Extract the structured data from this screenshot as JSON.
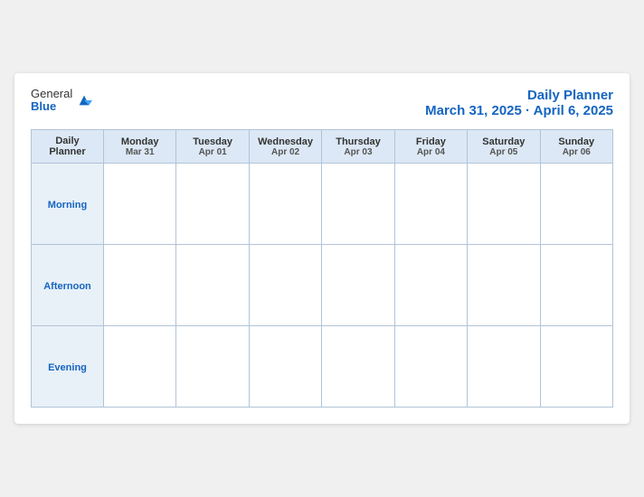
{
  "logo": {
    "general": "General",
    "blue": "Blue"
  },
  "header": {
    "title": "Daily Planner",
    "date_range": "March 31, 2025 · April 6, 2025"
  },
  "table": {
    "label_header": "Daily\nPlanner",
    "columns": [
      {
        "day": "Monday",
        "date": "Mar 31"
      },
      {
        "day": "Tuesday",
        "date": "Apr 01"
      },
      {
        "day": "Wednesday",
        "date": "Apr 02"
      },
      {
        "day": "Thursday",
        "date": "Apr 03"
      },
      {
        "day": "Friday",
        "date": "Apr 04"
      },
      {
        "day": "Saturday",
        "date": "Apr 05"
      },
      {
        "day": "Sunday",
        "date": "Apr 06"
      }
    ],
    "rows": [
      {
        "label": "Morning"
      },
      {
        "label": "Afternoon"
      },
      {
        "label": "Evening"
      }
    ]
  }
}
